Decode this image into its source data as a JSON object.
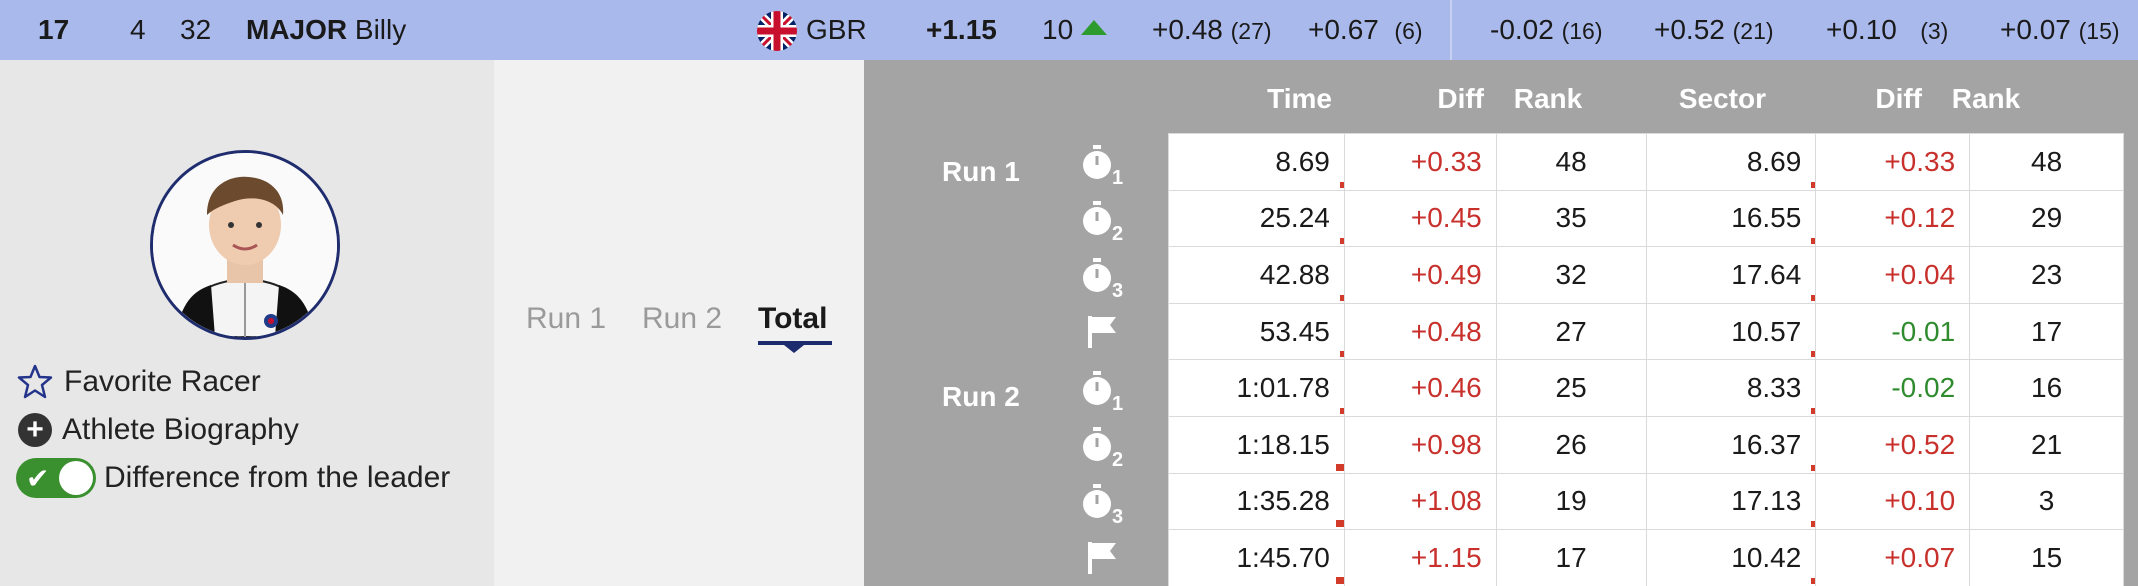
{
  "top": {
    "bib": "17",
    "col2": "4",
    "col3": "32",
    "last_name": "MAJOR",
    "first_name": "Billy",
    "country": "GBR",
    "total_diff": "+1.15",
    "rank": "10",
    "rank_trend": "up",
    "splits": [
      {
        "diff": "+0.48",
        "rank": "(27)"
      },
      {
        "diff": "+0.67",
        "rank": "(6)"
      },
      {
        "diff": "-0.02",
        "rank": "(16)"
      },
      {
        "diff": "+0.52",
        "rank": "(21)"
      },
      {
        "diff": "+0.10",
        "rank": "(3)"
      },
      {
        "diff": "+0.07",
        "rank": "(15)"
      }
    ]
  },
  "profile": {
    "favorite_label": "Favorite Racer",
    "biography_label": "Athlete Biography",
    "diff_leader_label": "Difference from the leader",
    "diff_leader_on": true
  },
  "tabs": [
    {
      "label": "Run 1",
      "active": false
    },
    {
      "label": "Run 2",
      "active": false
    },
    {
      "label": "Total",
      "active": true
    }
  ],
  "table": {
    "headers": {
      "time": "Time",
      "diff": "Diff",
      "rank": "Rank",
      "sector": "Sector",
      "sdiff": "Diff",
      "srank": "Rank"
    },
    "runs": [
      {
        "label": "Run 1",
        "intermediates": [
          "1",
          "2",
          "3"
        ]
      },
      {
        "label": "Run 2",
        "intermediates": [
          "1",
          "2",
          "3"
        ]
      }
    ],
    "rows": [
      {
        "time": "8.69",
        "diff": "+0.33",
        "rank": "48",
        "sector": "8.69",
        "sdiff": "+0.33",
        "srank": "48"
      },
      {
        "time": "25.24",
        "diff": "+0.45",
        "rank": "35",
        "sector": "16.55",
        "sdiff": "+0.12",
        "srank": "29"
      },
      {
        "time": "42.88",
        "diff": "+0.49",
        "rank": "32",
        "sector": "17.64",
        "sdiff": "+0.04",
        "srank": "23"
      },
      {
        "time": "53.45",
        "diff": "+0.48",
        "rank": "27",
        "sector": "10.57",
        "sdiff": "-0.01",
        "srank": "17"
      },
      {
        "time": "1:01.78",
        "diff": "+0.46",
        "rank": "25",
        "sector": "8.33",
        "sdiff": "-0.02",
        "srank": "16"
      },
      {
        "time": "1:18.15",
        "diff": "+0.98",
        "rank": "26",
        "sector": "16.37",
        "sdiff": "+0.52",
        "srank": "21"
      },
      {
        "time": "1:35.28",
        "diff": "+1.08",
        "rank": "19",
        "sector": "17.13",
        "sdiff": "+0.10",
        "srank": "3"
      },
      {
        "time": "1:45.70",
        "diff": "+1.15",
        "rank": "17",
        "sector": "10.42",
        "sdiff": "+0.07",
        "srank": "15"
      }
    ]
  },
  "colors": {
    "topbar": "#aab9eb",
    "positive_diff": "#c8302c",
    "negative_diff": "#2e8b2e",
    "tab_active": "#1c2a6e",
    "toggle_on": "#3a8f2e"
  }
}
